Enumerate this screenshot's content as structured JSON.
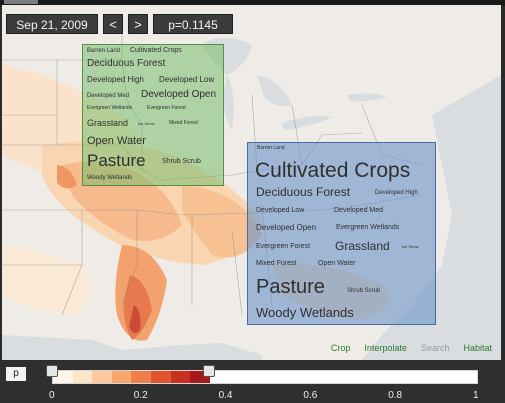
{
  "toolbar": {
    "date": "Sep 21, 2009",
    "prev": "<",
    "next": ">",
    "p_value": "p=0.1145"
  },
  "green_cloud": [
    {
      "text": "Barren Land",
      "size": 6
    },
    {
      "text": "Cultivated Crops",
      "size": 7
    },
    {
      "text": "Deciduous Forest",
      "size": 10
    },
    {
      "text": "Developed High",
      "size": 8
    },
    {
      "text": "Developed Low",
      "size": 8
    },
    {
      "text": "Developed Med",
      "size": 6
    },
    {
      "text": "Developed Open",
      "size": 10
    },
    {
      "text": "Evergreen Wetlands",
      "size": 5
    },
    {
      "text": "Evergreen Forest",
      "size": 5
    },
    {
      "text": "Grassland",
      "size": 9
    },
    {
      "text": "Ice Snow",
      "size": 4
    },
    {
      "text": "Mixed Forest",
      "size": 5
    },
    {
      "text": "Open Water",
      "size": 11
    },
    {
      "text": "Pasture",
      "size": 17
    },
    {
      "text": "Shrub Scrub",
      "size": 7
    },
    {
      "text": "Woody Wetlands",
      "size": 6
    }
  ],
  "blue_cloud": [
    {
      "text": "Barren Land",
      "size": 5
    },
    {
      "text": "Cultivated Crops",
      "size": 21
    },
    {
      "text": "Deciduous Forest",
      "size": 12
    },
    {
      "text": "Developed High",
      "size": 6
    },
    {
      "text": "Developed Low",
      "size": 7
    },
    {
      "text": "Developed Med",
      "size": 7
    },
    {
      "text": "Developed Open",
      "size": 8
    },
    {
      "text": "Evergreen Wetlands",
      "size": 7
    },
    {
      "text": "Evergreen Forest",
      "size": 7
    },
    {
      "text": "Grassland",
      "size": 12
    },
    {
      "text": "Ice Snow",
      "size": 4
    },
    {
      "text": "Mixed Forest",
      "size": 7
    },
    {
      "text": "Open Water",
      "size": 7
    },
    {
      "text": "Pasture",
      "size": 20
    },
    {
      "text": "Shrub Scrub",
      "size": 6
    },
    {
      "text": "Woody Wetlands",
      "size": 13
    }
  ],
  "map_links": {
    "crop": "Crop",
    "interpolate": "Interpolate",
    "search": "Search",
    "habitat": "Habitat"
  },
  "legend": {
    "label": "p",
    "colors": [
      "#fff6ea",
      "#fde5c8",
      "#fbc99b",
      "#f8a86e",
      "#f0804a",
      "#e05530",
      "#c8301f",
      "#a5181b"
    ],
    "min_handle": 0.0,
    "max_handle": 0.37,
    "ticks": [
      "0",
      "0.2",
      "0.4",
      "0.6",
      "0.8",
      "1"
    ]
  }
}
